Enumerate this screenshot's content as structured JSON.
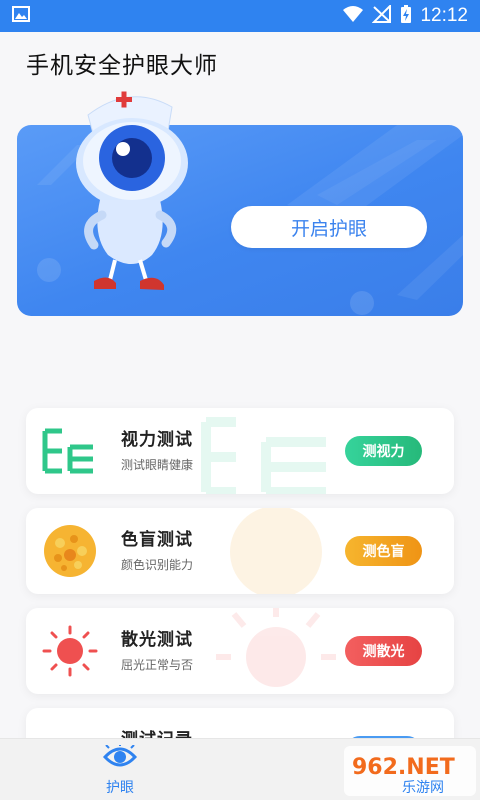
{
  "status_bar": {
    "time": "12:12"
  },
  "app": {
    "title": "手机安全护眼大师"
  },
  "hero": {
    "button_label": "开启护眼"
  },
  "cards": [
    {
      "title": "视力测试",
      "subtitle": "测试眼睛健康",
      "button": "测视力",
      "color": "#2fc78a"
    },
    {
      "title": "色盲测试",
      "subtitle": "颜色识别能力",
      "button": "测色盲",
      "color": "#f3a21f"
    },
    {
      "title": "散光测试",
      "subtitle": "屈光正常与否",
      "button": "测散光",
      "color": "#ef5050"
    },
    {
      "title": "测试记录",
      "subtitle": "",
      "button": "",
      "color": "#4a9bf2"
    }
  ],
  "nav": {
    "items": [
      {
        "label": "护眼",
        "active": true
      }
    ]
  },
  "watermark": {
    "brand": "962.NET",
    "sub": "乐游网"
  },
  "colors": {
    "primary": "#2f83f0"
  }
}
